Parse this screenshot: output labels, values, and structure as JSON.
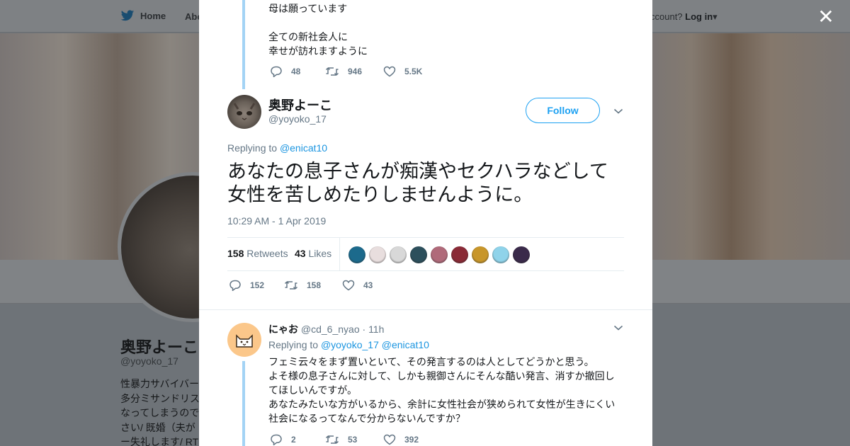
{
  "background": {
    "nav": {
      "home_label": "Home",
      "about_label": "Abo",
      "account_prompt": "ccount?",
      "login_label": "Log in"
    },
    "profile": {
      "name": "奥野よーこ",
      "handle": "@yoyoko_17",
      "bio_lines": [
        "性暴力サバイバー",
        "多分ミサンドリス",
        "なってしまうので",
        "さい/ 既婚（夫が",
        "ー失礼します/ RT"
      ]
    }
  },
  "close_icon": "close-icon",
  "previous_tweet": {
    "text_lines": [
      "母は願っています",
      "",
      "全ての新社会人に",
      "幸せが訪れますように"
    ],
    "replies": "48",
    "retweets": "946",
    "likes": "5.5K"
  },
  "main_tweet": {
    "author_name": "奥野よーこ",
    "author_handle": "@yoyoko_17",
    "follow_label": "Follow",
    "replying_prefix": "Replying to",
    "replying_to": "@enicat10",
    "text": "あなたの息子さんが痴漢やセクハラなどして女性を苦しめたりしませんように。",
    "timestamp": "10:29 AM - 1 Apr 2019",
    "retweet_count": "158",
    "retweet_label": "Retweets",
    "like_count": "43",
    "like_label": "Likes",
    "liker_avatar_colors": [
      "#1c6a8c",
      "#e8dede",
      "#d8d8d8",
      "#2c4f5c",
      "#b06a7a",
      "#8a2a36",
      "#c8962a",
      "#8fd3ea",
      "#3a2a4a"
    ],
    "replies": "152",
    "retweets": "158",
    "likes": "43"
  },
  "reply_tweet": {
    "author_name": "にゃお",
    "author_handle": "@cd_6_nyao",
    "time": "11h",
    "replying_prefix": "Replying to",
    "replying_to_1": "@yoyoko_17",
    "replying_to_2": "@enicat10",
    "text_lines": [
      "フェミ云々をまず置いといて、その発言するのは人としてどうかと思う。",
      "よそ様の息子さんに対して、しかも親御さんにそんな酷い発言、消すか撤回し",
      "てほしいんですが。",
      "あなたみたいな方がいるから、余計に女性社会が狭められて女性が生きにくい",
      "社会になるってなんで分からないんですか？"
    ],
    "replies": "2",
    "retweets": "53",
    "likes": "392"
  },
  "colors": {
    "accent": "#1da1f2",
    "thread_line": "#a3d3f5",
    "muted_text": "#657786"
  }
}
